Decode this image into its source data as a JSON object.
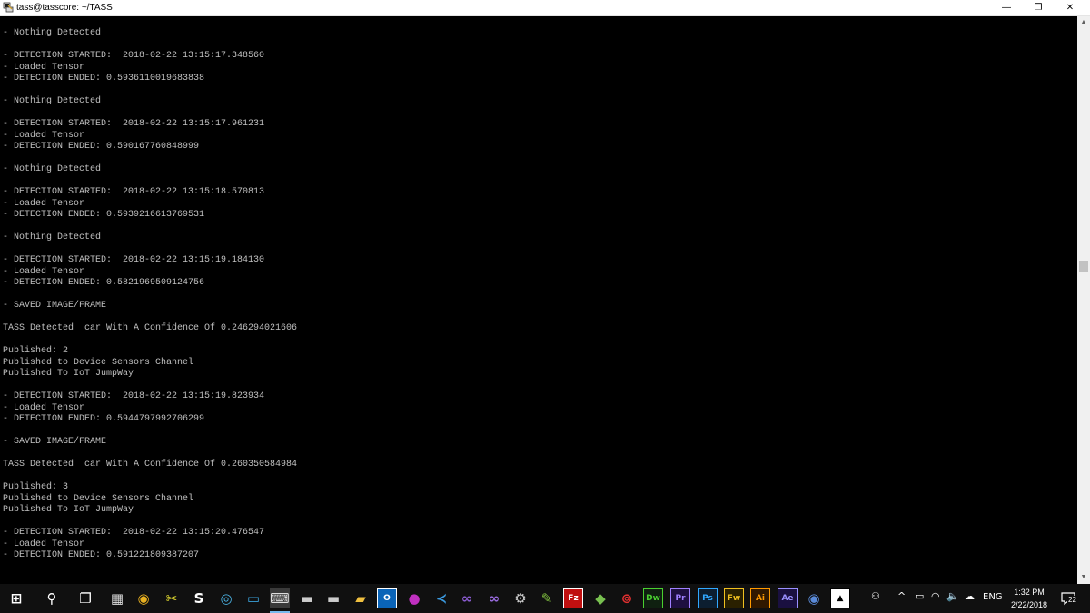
{
  "window": {
    "title": "tass@tasscore: ~/TASS",
    "minimize_glyph": "—",
    "maximize_glyph": "❐",
    "close_glyph": "✕"
  },
  "terminal": {
    "lines": [
      "- Nothing Detected",
      "",
      "- DETECTION STARTED:  2018-02-22 13:15:17.348560",
      "- Loaded Tensor",
      "- DETECTION ENDED: 0.5936110019683838",
      "",
      "- Nothing Detected",
      "",
      "- DETECTION STARTED:  2018-02-22 13:15:17.961231",
      "- Loaded Tensor",
      "- DETECTION ENDED: 0.590167760848999",
      "",
      "- Nothing Detected",
      "",
      "- DETECTION STARTED:  2018-02-22 13:15:18.570813",
      "- Loaded Tensor",
      "- DETECTION ENDED: 0.5939216613769531",
      "",
      "- Nothing Detected",
      "",
      "- DETECTION STARTED:  2018-02-22 13:15:19.184130",
      "- Loaded Tensor",
      "- DETECTION ENDED: 0.5821969509124756",
      "",
      "- SAVED IMAGE/FRAME",
      "",
      "TASS Detected  car With A Confidence Of 0.246294021606",
      "",
      "Published: 2",
      "Published to Device Sensors Channel",
      "Published To IoT JumpWay",
      "",
      "- DETECTION STARTED:  2018-02-22 13:15:19.823934",
      "- Loaded Tensor",
      "- DETECTION ENDED: 0.5944797992706299",
      "",
      "- SAVED IMAGE/FRAME",
      "",
      "TASS Detected  car With A Confidence Of 0.260350584984",
      "",
      "Published: 3",
      "Published to Device Sensors Channel",
      "Published To IoT JumpWay",
      "",
      "- DETECTION STARTED:  2018-02-22 13:15:20.476547",
      "- Loaded Tensor",
      "- DETECTION ENDED: 0.591221809387207"
    ]
  },
  "scrollbar": {
    "up_glyph": "▲",
    "down_glyph": "▼"
  },
  "taskbar": {
    "apps": [
      {
        "name": "start-icon",
        "glyph": "⊞",
        "bg": "",
        "color": "#ffffff"
      },
      {
        "name": "search-icon",
        "glyph": "⚲",
        "bg": "",
        "color": "#ffffff"
      },
      {
        "name": "task-view-icon",
        "glyph": "❐",
        "bg": "",
        "color": "#ffffff"
      },
      {
        "name": "calculator-icon",
        "glyph": "▦",
        "bg": "",
        "color": "#dddddd"
      },
      {
        "name": "chrome-icon",
        "glyph": "◉",
        "bg": "",
        "color": "#e8b020"
      },
      {
        "name": "snipping-tool-icon",
        "glyph": "✂",
        "bg": "",
        "color": "#e8e030"
      },
      {
        "name": "skype-icon",
        "glyph": "S",
        "bg": "",
        "color": "#ffffff"
      },
      {
        "name": "app-ring-icon",
        "glyph": "◎",
        "bg": "",
        "color": "#4ab0e0"
      },
      {
        "name": "remote-desktop-icon",
        "glyph": "▭",
        "bg": "",
        "color": "#3aa0d8"
      },
      {
        "name": "putty-icon",
        "glyph": "⌨",
        "bg": "",
        "color": "#dddddd"
      },
      {
        "name": "window-icon",
        "glyph": "▬",
        "bg": "",
        "color": "#cccccc"
      },
      {
        "name": "terminal-icon",
        "glyph": "▬",
        "bg": "",
        "color": "#cccccc"
      },
      {
        "name": "file-explorer-icon",
        "glyph": "▰",
        "bg": "",
        "color": "#f0c040"
      },
      {
        "name": "outlook-icon",
        "glyph": "O",
        "bg": "#0a64b8",
        "color": "#ffffff"
      },
      {
        "name": "github-icon",
        "glyph": "●",
        "bg": "",
        "color": "#c030c0"
      },
      {
        "name": "vscode-icon",
        "glyph": "≺",
        "bg": "",
        "color": "#3b9ae0"
      },
      {
        "name": "visual-studio-icon",
        "glyph": "∞",
        "bg": "",
        "color": "#8a5cd0"
      },
      {
        "name": "visual-studio-2-icon",
        "glyph": "∞",
        "bg": "",
        "color": "#9a6ce0"
      },
      {
        "name": "steam-icon",
        "glyph": "⚙",
        "bg": "",
        "color": "#cccccc"
      },
      {
        "name": "notepad-plus-icon",
        "glyph": "✎",
        "bg": "",
        "color": "#80c040"
      },
      {
        "name": "filezilla-icon",
        "glyph": "Fz",
        "bg": "#c01010",
        "color": "#ffffff"
      },
      {
        "name": "android-studio-icon",
        "glyph": "◆",
        "bg": "",
        "color": "#78c050"
      },
      {
        "name": "creative-cloud-icon",
        "glyph": "⊚",
        "bg": "",
        "color": "#e03030"
      },
      {
        "name": "dreamweaver-icon",
        "glyph": "Dw",
        "bg": "#0f2010",
        "color": "#4ad030"
      },
      {
        "name": "premiere-icon",
        "glyph": "Pr",
        "bg": "#1e1040",
        "color": "#a080ff"
      },
      {
        "name": "photoshop-icon",
        "glyph": "Ps",
        "bg": "#0c1e30",
        "color": "#31a8ff"
      },
      {
        "name": "fireworks-icon",
        "glyph": "Fw",
        "bg": "#2a2000",
        "color": "#f0c020"
      },
      {
        "name": "illustrator-icon",
        "glyph": "Ai",
        "bg": "#301800",
        "color": "#ff9a00"
      },
      {
        "name": "after-effects-icon",
        "glyph": "Ae",
        "bg": "#1a1040",
        "color": "#9a90ff"
      },
      {
        "name": "globe-app-icon",
        "glyph": "◉",
        "bg": "",
        "color": "#5a8ad8"
      },
      {
        "name": "photos-icon",
        "glyph": "▲",
        "bg": "#ffffff",
        "color": "#000000"
      }
    ],
    "tray": {
      "people_glyph": "⚇",
      "chevron_glyph": "^",
      "battery_glyph": "▭",
      "wifi_glyph": "◠",
      "volume_glyph": "🔈",
      "cloud_glyph": "☁",
      "language": "ENG",
      "time": "1:32 PM",
      "date": "2/22/2018",
      "notification_glyph": "▤",
      "notification_count": "22"
    }
  }
}
